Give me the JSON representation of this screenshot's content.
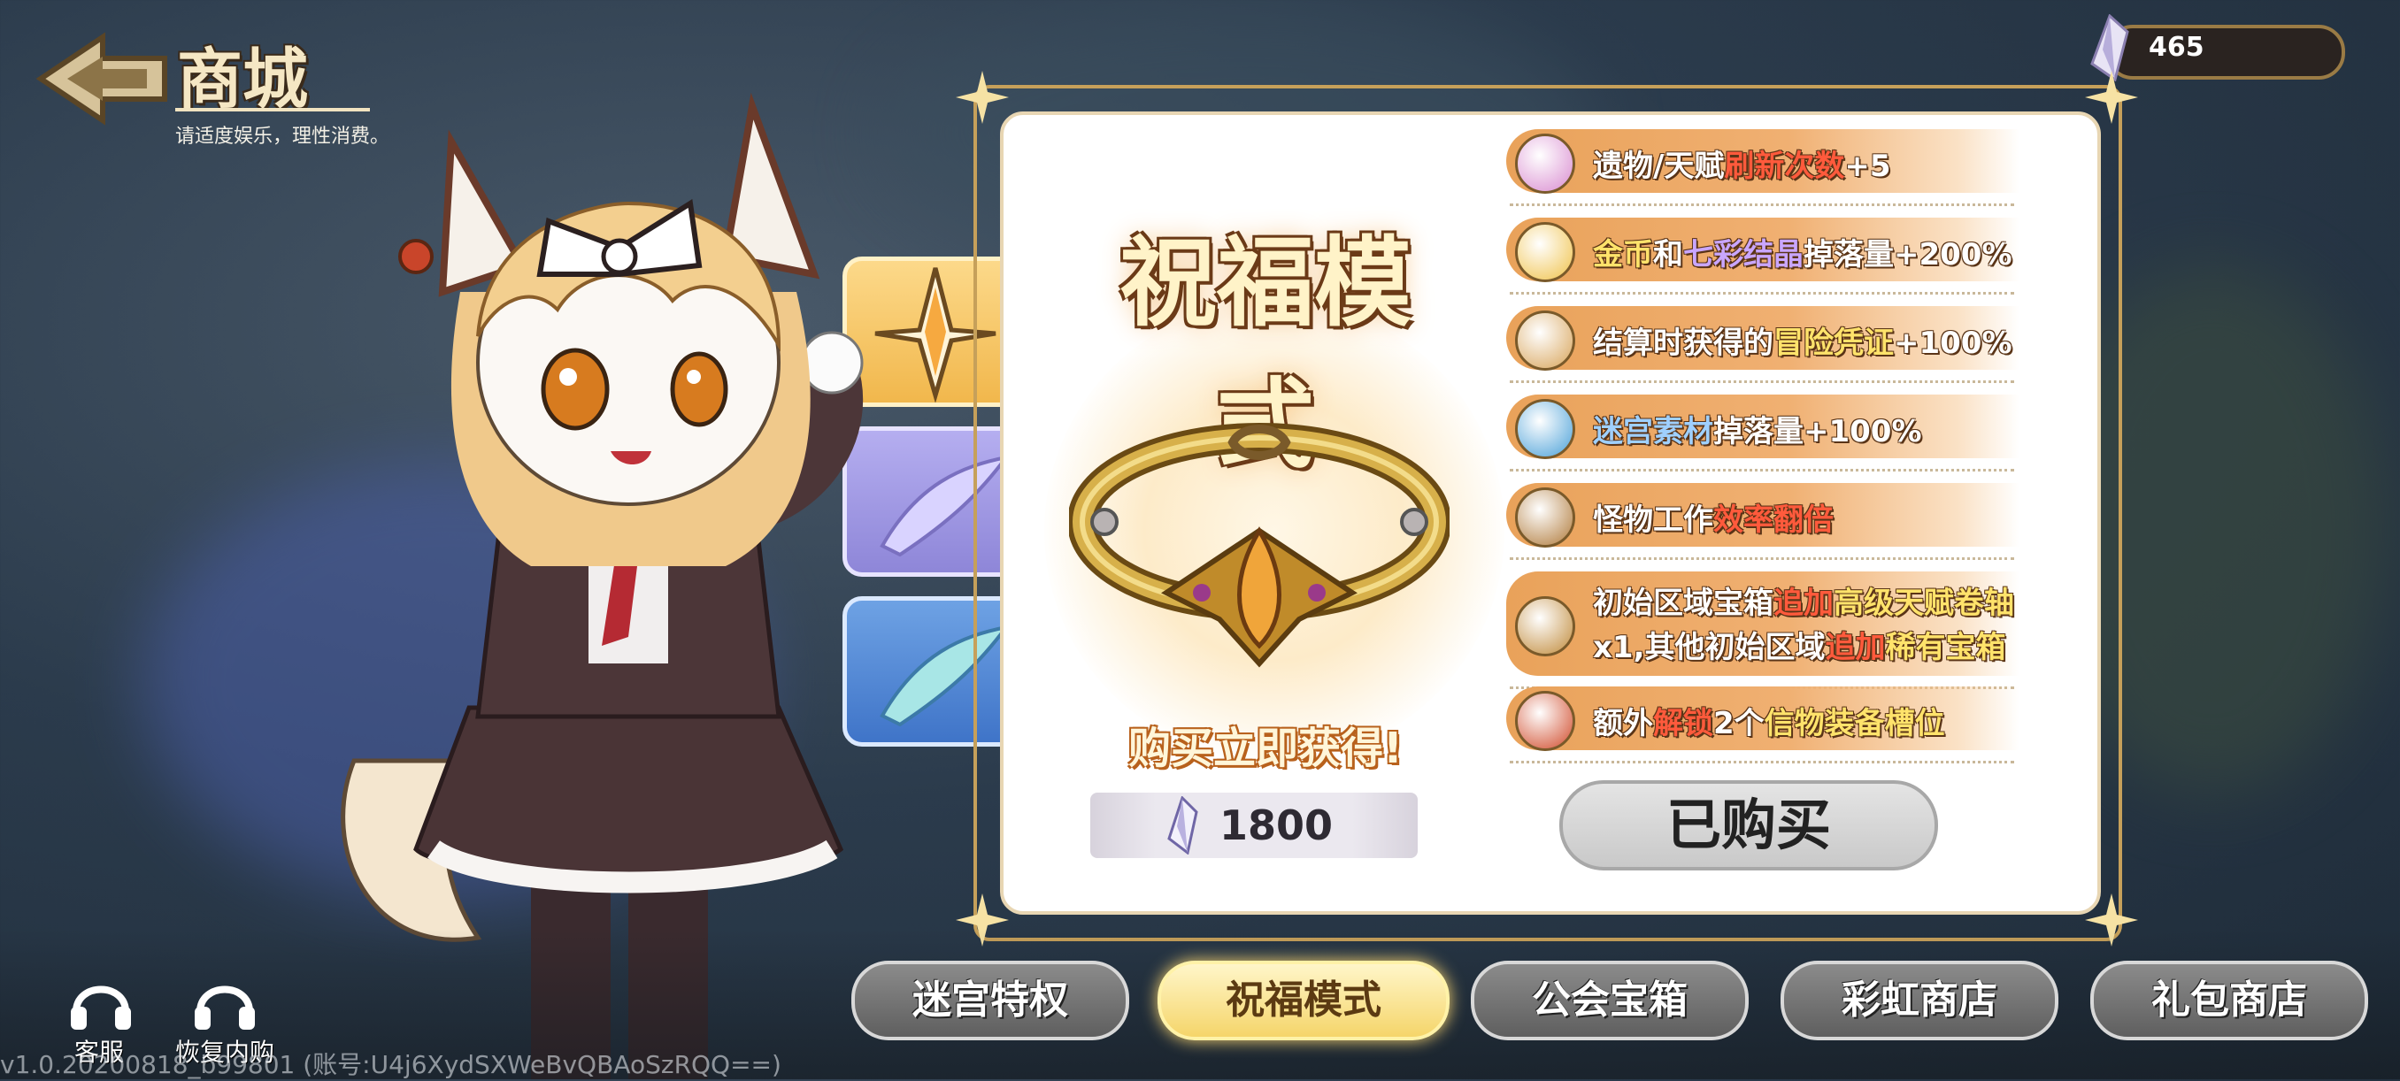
{
  "header": {
    "title": "商城",
    "subtitle": "请适度娱乐，理性消费。"
  },
  "currency": {
    "amount": "465",
    "icon": "crystal-icon"
  },
  "mode": {
    "title": "祝福模式",
    "buy_prompt": "购买立即获得!",
    "price": "1800",
    "status_button": "已购买"
  },
  "benefits": [
    {
      "icon": "lollipop-icon",
      "parts": [
        "遗物/天赋",
        "刷新次数",
        "+5"
      ]
    },
    {
      "icon": "coin-crystal-icon",
      "parts": [
        "金币",
        "和",
        "七彩结晶",
        "掉落量+200%"
      ]
    },
    {
      "icon": "scroll-icon",
      "parts": [
        "结算时获得的",
        "冒险凭证",
        "+100%"
      ]
    },
    {
      "icon": "material-icon",
      "parts": [
        "迷宫素材",
        "掉落量+100%"
      ]
    },
    {
      "icon": "clock-icon",
      "parts": [
        "怪物工作",
        "效率翻倍"
      ]
    },
    {
      "icon": "chest-icon",
      "line1": [
        "初始区域宝箱",
        "追加",
        "高级天赋卷轴"
      ],
      "line2": [
        "x1,其他初始区域",
        "追加",
        "稀有宝箱"
      ]
    },
    {
      "icon": "badge-icon",
      "parts": [
        "额外",
        "解锁",
        "2个",
        "信物装备槽位"
      ]
    }
  ],
  "nav_tabs": [
    {
      "label": "迷宫特权",
      "active": false
    },
    {
      "label": "祝福模式",
      "active": true
    },
    {
      "label": "公会宝箱",
      "active": false
    },
    {
      "label": "彩虹商店",
      "active": false
    },
    {
      "label": "礼包商店",
      "active": false
    }
  ],
  "bottom_buttons": {
    "support": "客服",
    "restore": "恢复内购"
  },
  "version_text": "v1.0.20200818_b99801 (账号:U4j6XydSXWeBvQBAoSzRQQ==)",
  "colors": {
    "accent_orange": "#e9a25a",
    "gold": "#c6a05a",
    "highlight_red": "#ff5a3c",
    "highlight_yellow": "#ffe36b"
  }
}
